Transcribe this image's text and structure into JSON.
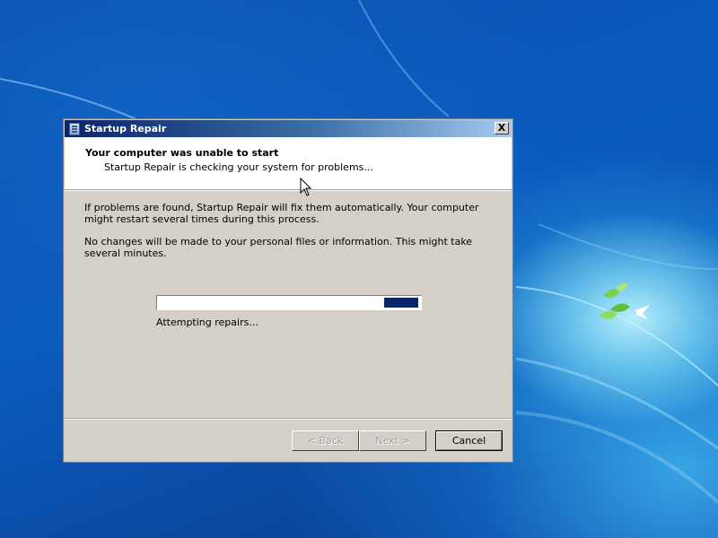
{
  "window": {
    "title": "Startup Repair",
    "close_glyph": "X"
  },
  "header": {
    "title": "Your computer was unable to start",
    "subtitle": "Startup Repair is checking your system for problems..."
  },
  "body": {
    "paragraph1": "If problems are found, Startup Repair will fix them automatically. Your computer might restart several times during this process.",
    "paragraph2": "No changes will be made to your personal files or information. This might take several minutes."
  },
  "progress": {
    "status_text": "Attempting repairs...",
    "chunk_start_fraction": 0.86,
    "chunk_width_fraction": 0.13,
    "chunk_color": "#0a246a"
  },
  "buttons": {
    "back_label": "< Back",
    "next_label": "Next >",
    "cancel_label": "Cancel"
  },
  "icons": {
    "app": "startup-repair-icon",
    "close": "close-icon",
    "pointer": "mouse-pointer-icon"
  },
  "colors": {
    "titlebar_start": "#0a246a",
    "dialog_face": "#d4d0c8",
    "desktop_blue": "#0a5bbf"
  }
}
